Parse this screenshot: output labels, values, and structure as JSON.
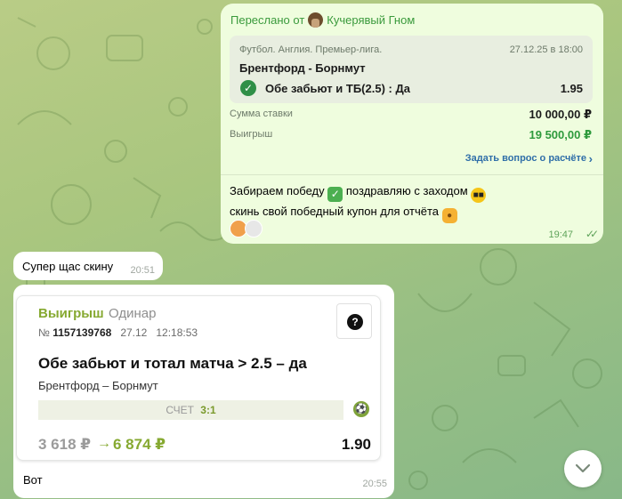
{
  "forwarded": {
    "prefix": "Переслано от",
    "sender": "Кучерявый Гном",
    "bet": {
      "league": "Футбол. Англия. Премьер-лига.",
      "datetime": "27.12.25 в 18:00",
      "match": "Брентфорд - Борнмут",
      "outcome": "Обе забьют и ТБ(2.5) : Да",
      "odds": "1.95"
    },
    "stake_label": "Сумма ставки",
    "stake_value": "10 000,00 ₽",
    "win_label": "Выигрыш",
    "win_value": "19 500,00 ₽",
    "ask_link": "Задать вопрос о расчёте",
    "message_line1": "Забираем победу",
    "message_line1b": "поздравляю с заходом",
    "message_line2": "скинь свой победный купон для отчёта",
    "time": "19:47",
    "colors": {
      "bubble": "#effdde",
      "accent_green": "#3a9a3c",
      "win_green": "#2e9a3c"
    }
  },
  "reply_short": {
    "text": "Супер щас скину",
    "time": "20:51"
  },
  "coupon": {
    "status": "Выигрыш",
    "type": "Одинар",
    "number_prefix": "№",
    "number": "1157139768",
    "date": "27.12",
    "time": "12:18:53",
    "title": "Обе забьют и тотал матча > 2.5 – да",
    "match": "Брентфорд – Борнмут",
    "score_label": "СЧЕТ",
    "score": "3:1",
    "stake": "3 618 ₽",
    "arrow": "→",
    "payout": "6 874 ₽",
    "odds": "1.90",
    "help_icon": "?"
  },
  "reply_photo": {
    "caption": "Вот",
    "time": "20:55"
  },
  "scroll_button": {
    "icon": "chevron-down-icon"
  }
}
